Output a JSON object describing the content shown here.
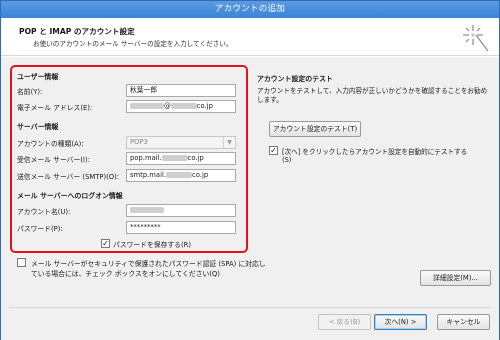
{
  "window": {
    "title": "アカウントの追加"
  },
  "header": {
    "title": "POP と IMAP のアカウント設定",
    "subtitle": "お使いのアカウントのメール サーバーの設定を入力してください。"
  },
  "user_info": {
    "section": "ユーザー情報",
    "name_label": "名前(Y):",
    "name_value": "秋葉一郎",
    "email_label": "電子メール アドレス(E):",
    "email_at": "@",
    "email_suffix": "co.jp"
  },
  "server_info": {
    "section": "サーバー情報",
    "account_type_label": "アカウントの種類(A):",
    "account_type_value": "POP3",
    "incoming_label": "受信メール サーバー(I):",
    "incoming_prefix": "pop.mail.",
    "incoming_suffix": "co.jp",
    "outgoing_label": "送信メール サーバー (SMTP)(O):",
    "outgoing_prefix": "smtp.mail.",
    "outgoing_suffix": "co.jp"
  },
  "logon_info": {
    "section": "メール サーバーへのログオン情報",
    "account_name_label": "アカウント名(U):",
    "password_label": "パスワード(P):",
    "password_value": "*********",
    "remember_label": "パスワードを保存する(R)",
    "remember_checked": true
  },
  "spa": {
    "line1": "メール サーバーがセキュリティで保護されたパスワード認証 (SPA) に対応し",
    "line2": "ている場合には、チェック ボックスをオンにしてください(Q)",
    "checked": false
  },
  "test": {
    "title": "アカウント設定のテスト",
    "desc_line1": "アカウントをテストして、入力内容が正しいかどうかを確認することをお勧め",
    "desc_line2": "します。",
    "test_button": "アカウント設定のテスト(T)",
    "auto_test_line1": "[次へ] をクリックしたらアカウント設定を自動的にテストする",
    "auto_test_line2": "(S)",
    "auto_test_checked": true
  },
  "buttons": {
    "advanced": "詳細設定(M)...",
    "back": "< 戻る(B)",
    "next": "次へ(N) >",
    "cancel": "キャンセル"
  },
  "colors": {
    "highlight": "#e0141e",
    "titlebar": "#3c84d6"
  }
}
